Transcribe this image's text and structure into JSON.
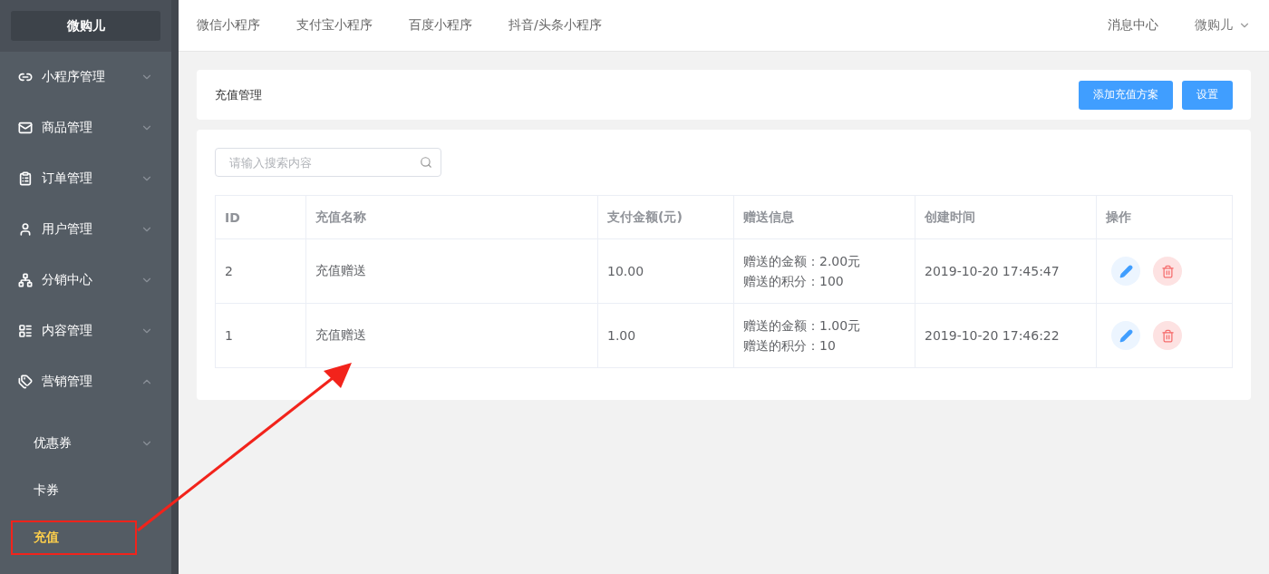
{
  "sidebar": {
    "logo": "微购儿",
    "items": [
      {
        "label": "小程序管理",
        "expanded": false
      },
      {
        "label": "商品管理",
        "expanded": false
      },
      {
        "label": "订单管理",
        "expanded": false
      },
      {
        "label": "用户管理",
        "expanded": false
      },
      {
        "label": "分销中心",
        "expanded": false
      },
      {
        "label": "内容管理",
        "expanded": false
      },
      {
        "label": "营销管理",
        "expanded": true,
        "children": [
          {
            "label": "优惠券",
            "expandable": true,
            "selected": false
          },
          {
            "label": "卡券",
            "expandable": false,
            "selected": false
          },
          {
            "label": "充值",
            "expandable": false,
            "selected": true
          }
        ]
      }
    ]
  },
  "header": {
    "nav": [
      "微信小程序",
      "支付宝小程序",
      "百度小程序",
      "抖音/头条小程序"
    ],
    "messages": "消息中心",
    "user": "微购儿"
  },
  "page": {
    "title": "充值管理",
    "buttons": [
      "添加充值方案",
      "设置"
    ]
  },
  "search": {
    "placeholder": "请输入搜索内容"
  },
  "table": {
    "columns": [
      "ID",
      "充值名称",
      "支付金额(元)",
      "赠送信息",
      "创建时间",
      "操作"
    ],
    "rows": [
      {
        "id": "2",
        "name": "充值赠送",
        "amount": "10.00",
        "gift": [
          "赠送的金额：2.00元",
          "赠送的积分：100"
        ],
        "created": "2019-10-20 17:45:47"
      },
      {
        "id": "1",
        "name": "充值赠送",
        "amount": "1.00",
        "gift": [
          "赠送的金额：1.00元",
          "赠送的积分：10"
        ],
        "created": "2019-10-20 17:46:22"
      }
    ]
  }
}
